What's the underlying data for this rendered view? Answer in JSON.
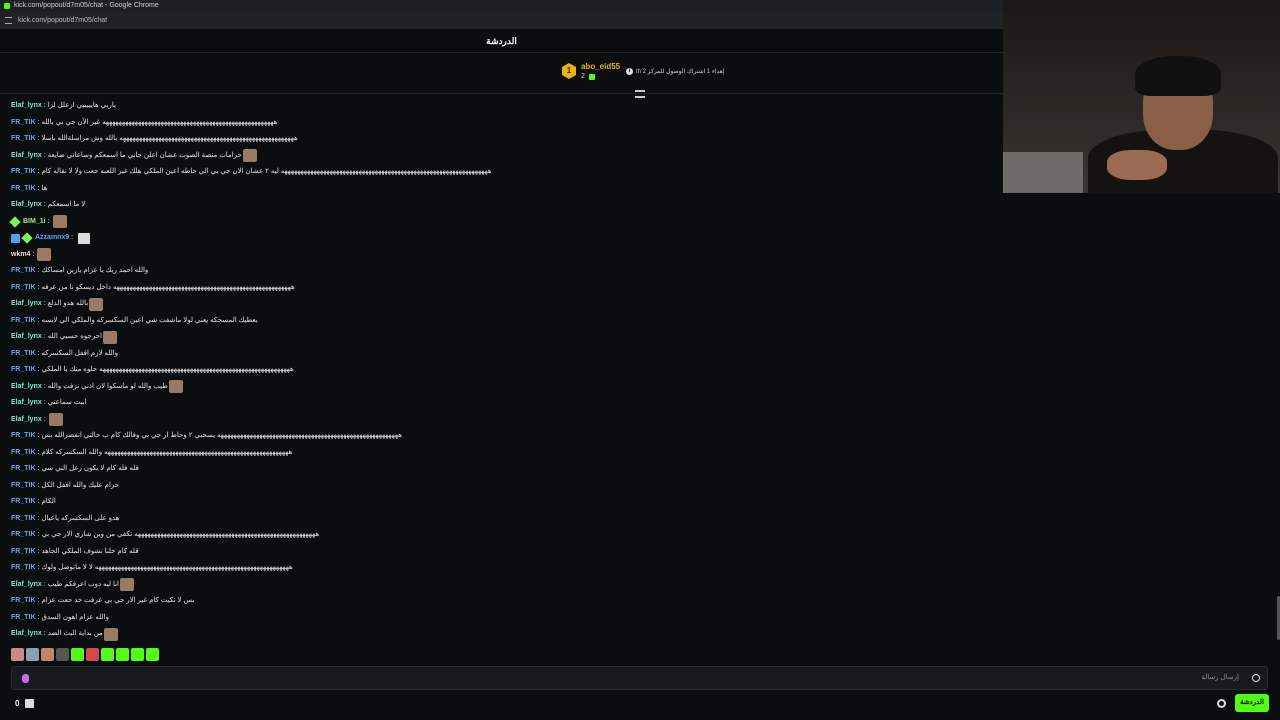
{
  "browser": {
    "title": "kick.com/popout/d7m05/chat - Google Chrome",
    "url": "kick.com/popout/d7m05/chat"
  },
  "header": {
    "title": "الدردشة"
  },
  "pinned": {
    "rank": "1",
    "username": "abo_eid55",
    "count": "2",
    "text": "th إهداء 1 اشتراك الوصول للمركز 2"
  },
  "messages": [
    {
      "user": "Elaf_lynx",
      "text": "ياربي هايييييي ازعلل لزا"
    },
    {
      "user": "FR_TIK",
      "text": "هههههههههههههههههههههههههههههههههههههههههههههههههههههه غير الأن جي بي بالله"
    },
    {
      "user": "FR_TIK",
      "text": "ههههههههههههههههههههههههههههههههههههههههههههههههههههههه بالله وش مراسلةالله باسلا"
    },
    {
      "user": "Elaf_lynx",
      "text": "حرامات منصة الصوت عشان اعلن جاني ما اسمعكم وساعاتي ضايعة"
    },
    {
      "user": "FR_TIK",
      "text": "ههههههههههههههههههههههههههههههههههههههههههههههههههههههههههههههههه ليه ٢ عشان الان جي بي الي حاطه اعين الملكي هلك غير اللعبه حعت ولا لا نقاله كام"
    },
    {
      "user": "FR_TIK",
      "text": "ها"
    },
    {
      "user": "Elaf_lynx",
      "text": "لا ما اسمعكم"
    },
    {
      "user": "BIM_1i",
      "text": ""
    },
    {
      "user": "Azzamnx9",
      "text": ""
    },
    {
      "user": "wkm4",
      "text": ""
    },
    {
      "user": "FR_TIK",
      "text": "والله احمد ريك يا عزام يازين امساكك"
    },
    {
      "user": "FR_TIK",
      "text": "هههههههههههههههههههههههههههههههههههههههههههههههههههههههه داخل ديسكو نا من عرفه"
    },
    {
      "user": "Elaf_lynx",
      "text": "بالله هدو الدلع"
    },
    {
      "user": "FR_TIK",
      "text": "يعطيك المسحكه يعني لولا ماشفت شي اعين السكسركه والملكي الي لابسه"
    },
    {
      "user": "Elaf_lynx",
      "text": "احرجوه حسبي الله"
    },
    {
      "user": "FR_TIK",
      "text": "والله لازم اقفل السكسركه"
    },
    {
      "user": "FR_TIK",
      "text": "هههههههههههههههههههههههههههههههههههههههههههههههههههههههههههه حلوه منك يا الملكي"
    },
    {
      "user": "Elaf_lynx",
      "text": "طيب والله لو ماسكوا لان اذني نزفت والله"
    },
    {
      "user": "Elaf_lynx",
      "text": "ابيت سماعتي"
    },
    {
      "user": "Elaf_lynx",
      "text": ""
    },
    {
      "user": "FR_TIK",
      "text": "ههههههههههههههههههههههههههههههههههههههههههههههههههههههههه يسحبي ٢ وحاط ار جي بي وفالك كام ب حالتي انفضرالله بس"
    },
    {
      "user": "FR_TIK",
      "text": "هههههههههههههههههههههههههههههههههههههههههههههههههههههههههه والله السكسركه كلام"
    },
    {
      "user": "FR_TIK",
      "text": "قله فله كام لا يكون زعل الني سي"
    },
    {
      "user": "FR_TIK",
      "text": "حرام عليك والله اقفل الكل"
    },
    {
      "user": "FR_TIK",
      "text": "الكام"
    },
    {
      "user": "FR_TIK",
      "text": "هدو على السكسركه ياعيال"
    },
    {
      "user": "FR_TIK",
      "text": "ههههههههههههههههههههههههههههههههههههههههههههههههههههههههه تكفي من وين شاري الار جي بي"
    },
    {
      "user": "FR_TIK",
      "text": "قله كام خلنا نشوف الملكي الجاهد"
    },
    {
      "user": "FR_TIK",
      "text": "ههههههههههههههههههههههههههههههههههههههههههههههههههههههههههههه لا لا ماتوصل ولوك"
    },
    {
      "user": "Elaf_lynx",
      "text": "انا ليه دوب اعرفكم طيب"
    },
    {
      "user": "FR_TIK",
      "text": "بس لا تكيت كام غير الار جي بي عرفت خذ حعت عزام"
    },
    {
      "user": "FR_TIK",
      "text": "والله عزام اهون السدق"
    },
    {
      "user": "Elaf_lynx",
      "text": "من بداية البث الضد"
    }
  ],
  "input": {
    "placeholder": "إرسال رسالة"
  },
  "footer": {
    "count": "0",
    "send_label": "الدردشة"
  },
  "colors": {
    "accent": "#53fc18",
    "elaf": "#75f0c8",
    "frtik": "#5fa8ee"
  }
}
